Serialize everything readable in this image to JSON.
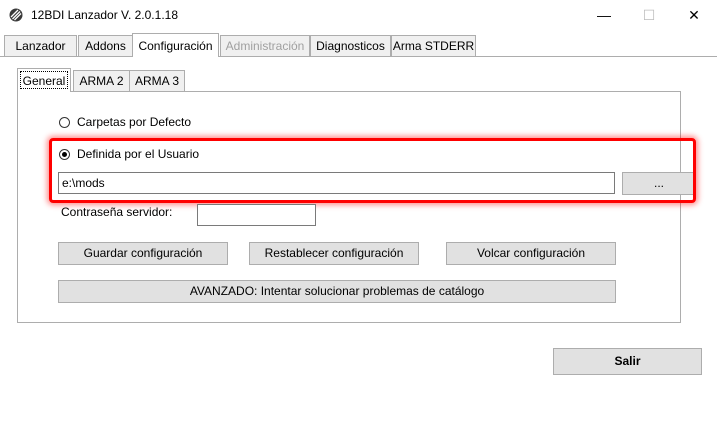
{
  "window": {
    "title": "12BDI Lanzador V. 2.0.1.18",
    "controls": {
      "minimize": "—",
      "maximize": "☐",
      "close": "✕"
    }
  },
  "main_tabs": [
    {
      "label": "Lanzador"
    },
    {
      "label": "Addons"
    },
    {
      "label": "Configuración"
    },
    {
      "label": "Administración"
    },
    {
      "label": "Diagnosticos"
    },
    {
      "label": "Arma STDERR"
    }
  ],
  "sub_tabs": [
    {
      "label": "General"
    },
    {
      "label": "ARMA 2"
    },
    {
      "label": "ARMA 3"
    }
  ],
  "folders": {
    "default_option": "Carpetas por Defecto",
    "user_option": "Definida por el Usuario",
    "path_value": "e:\\mods",
    "browse_label": "..."
  },
  "server_password": {
    "label": "Contraseña servidor:",
    "value": ""
  },
  "buttons": {
    "save": "Guardar configuración",
    "reset": "Restablecer configuración",
    "dump": "Volcar configuración",
    "advanced": "AVANZADO: Intentar solucionar problemas de catálogo",
    "exit": "Salir"
  },
  "colors": {
    "highlight": "#ff0000",
    "button_face": "#e1e1e1",
    "tab_face": "#f0f0f0",
    "border": "#adadad"
  }
}
